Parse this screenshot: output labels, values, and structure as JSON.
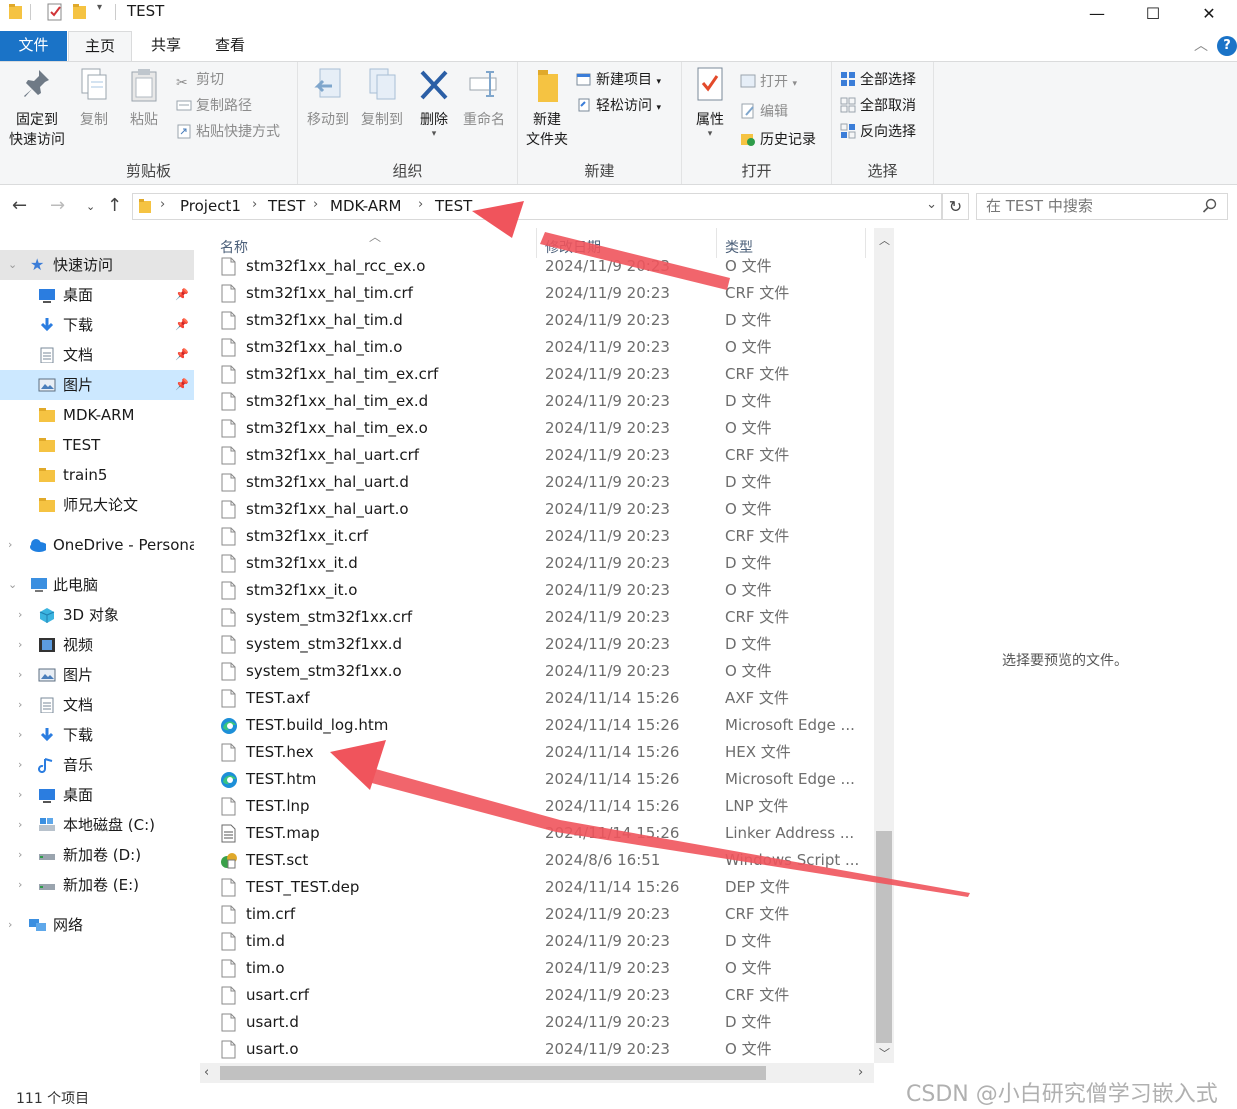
{
  "window": {
    "title": "TEST",
    "controls": {
      "minimize": "—",
      "maximize": "☐",
      "close": "✕"
    }
  },
  "ribbon_tabs": [
    "文件",
    "主页",
    "共享",
    "查看"
  ],
  "ribbon": {
    "clipboard": {
      "label": "剪贴板",
      "pin": "固定到\n快速访问",
      "pin_l1": "固定到",
      "pin_l2": "快速访问",
      "copy": "复制",
      "paste": "粘贴",
      "cut": "剪切",
      "copy_path": "复制路径",
      "paste_shortcut": "粘贴快捷方式"
    },
    "organize": {
      "label": "组织",
      "move_to": "移动到",
      "copy_to": "复制到",
      "delete": "删除",
      "rename": "重命名"
    },
    "new": {
      "label": "新建",
      "new_folder_l1": "新建",
      "new_folder_l2": "文件夹",
      "new_item": "新建项目",
      "easy_access": "轻松访问"
    },
    "open": {
      "label": "打开",
      "properties": "属性",
      "open": "打开",
      "edit": "编辑",
      "history": "历史记录"
    },
    "select": {
      "label": "选择",
      "select_all": "全部选择",
      "select_none": "全部取消",
      "invert": "反向选择"
    }
  },
  "breadcrumb": [
    "Project1",
    "TEST",
    "MDK-ARM",
    "TEST"
  ],
  "search": {
    "placeholder": "在 TEST 中搜索"
  },
  "nav": {
    "quick_access": "快速访问",
    "items": [
      {
        "label": "桌面",
        "icon": "desktop-icon",
        "pinned": true
      },
      {
        "label": "下载",
        "icon": "download-icon",
        "pinned": true
      },
      {
        "label": "文档",
        "icon": "document-icon",
        "pinned": true
      },
      {
        "label": "图片",
        "icon": "picture-icon",
        "pinned": true
      },
      {
        "label": "MDK-ARM",
        "icon": "folder-icon",
        "pinned": false
      },
      {
        "label": "TEST",
        "icon": "folder-icon",
        "pinned": false
      },
      {
        "label": "train5",
        "icon": "folder-icon",
        "pinned": false
      },
      {
        "label": "师兄大论文",
        "icon": "folder-icon",
        "pinned": false
      }
    ],
    "onedrive": "OneDrive - Persona",
    "this_pc": "此电脑",
    "pc_items": [
      {
        "label": "3D 对象",
        "icon": "cube-icon"
      },
      {
        "label": "视频",
        "icon": "video-icon"
      },
      {
        "label": "图片",
        "icon": "picture-icon"
      },
      {
        "label": "文档",
        "icon": "document-icon"
      },
      {
        "label": "下载",
        "icon": "download-icon"
      },
      {
        "label": "音乐",
        "icon": "music-icon"
      },
      {
        "label": "桌面",
        "icon": "desktop-icon"
      },
      {
        "label": "本地磁盘 (C:)",
        "icon": "disk-icon"
      },
      {
        "label": "新加卷 (D:)",
        "icon": "drive-icon"
      },
      {
        "label": "新加卷 (E:)",
        "icon": "drive-icon"
      }
    ],
    "network": "网络"
  },
  "columns": {
    "name": "名称",
    "date": "修改日期",
    "type": "类型"
  },
  "files": [
    {
      "name": "stm32f1xx_hal_rcc_ex.o",
      "date": "2024/11/9 20:23",
      "type": "O 文件",
      "icon": "file"
    },
    {
      "name": "stm32f1xx_hal_tim.crf",
      "date": "2024/11/9 20:23",
      "type": "CRF 文件",
      "icon": "file"
    },
    {
      "name": "stm32f1xx_hal_tim.d",
      "date": "2024/11/9 20:23",
      "type": "D 文件",
      "icon": "file"
    },
    {
      "name": "stm32f1xx_hal_tim.o",
      "date": "2024/11/9 20:23",
      "type": "O 文件",
      "icon": "file"
    },
    {
      "name": "stm32f1xx_hal_tim_ex.crf",
      "date": "2024/11/9 20:23",
      "type": "CRF 文件",
      "icon": "file"
    },
    {
      "name": "stm32f1xx_hal_tim_ex.d",
      "date": "2024/11/9 20:23",
      "type": "D 文件",
      "icon": "file"
    },
    {
      "name": "stm32f1xx_hal_tim_ex.o",
      "date": "2024/11/9 20:23",
      "type": "O 文件",
      "icon": "file"
    },
    {
      "name": "stm32f1xx_hal_uart.crf",
      "date": "2024/11/9 20:23",
      "type": "CRF 文件",
      "icon": "file"
    },
    {
      "name": "stm32f1xx_hal_uart.d",
      "date": "2024/11/9 20:23",
      "type": "D 文件",
      "icon": "file"
    },
    {
      "name": "stm32f1xx_hal_uart.o",
      "date": "2024/11/9 20:23",
      "type": "O 文件",
      "icon": "file"
    },
    {
      "name": "stm32f1xx_it.crf",
      "date": "2024/11/9 20:23",
      "type": "CRF 文件",
      "icon": "file"
    },
    {
      "name": "stm32f1xx_it.d",
      "date": "2024/11/9 20:23",
      "type": "D 文件",
      "icon": "file"
    },
    {
      "name": "stm32f1xx_it.o",
      "date": "2024/11/9 20:23",
      "type": "O 文件",
      "icon": "file"
    },
    {
      "name": "system_stm32f1xx.crf",
      "date": "2024/11/9 20:23",
      "type": "CRF 文件",
      "icon": "file"
    },
    {
      "name": "system_stm32f1xx.d",
      "date": "2024/11/9 20:23",
      "type": "D 文件",
      "icon": "file"
    },
    {
      "name": "system_stm32f1xx.o",
      "date": "2024/11/9 20:23",
      "type": "O 文件",
      "icon": "file"
    },
    {
      "name": "TEST.axf",
      "date": "2024/11/14 15:26",
      "type": "AXF 文件",
      "icon": "file"
    },
    {
      "name": "TEST.build_log.htm",
      "date": "2024/11/14 15:26",
      "type": "Microsoft Edge ...",
      "icon": "edge"
    },
    {
      "name": "TEST.hex",
      "date": "2024/11/14 15:26",
      "type": "HEX 文件",
      "icon": "file"
    },
    {
      "name": "TEST.htm",
      "date": "2024/11/14 15:26",
      "type": "Microsoft Edge ...",
      "icon": "edge"
    },
    {
      "name": "TEST.lnp",
      "date": "2024/11/14 15:26",
      "type": "LNP 文件",
      "icon": "file"
    },
    {
      "name": "TEST.map",
      "date": "2024/11/14 15:26",
      "type": "Linker Address ...",
      "icon": "text"
    },
    {
      "name": "TEST.sct",
      "date": "2024/8/6 16:51",
      "type": "Windows Script ...",
      "icon": "script"
    },
    {
      "name": "TEST_TEST.dep",
      "date": "2024/11/14 15:26",
      "type": "DEP 文件",
      "icon": "file"
    },
    {
      "name": "tim.crf",
      "date": "2024/11/9 20:23",
      "type": "CRF 文件",
      "icon": "file"
    },
    {
      "name": "tim.d",
      "date": "2024/11/9 20:23",
      "type": "D 文件",
      "icon": "file"
    },
    {
      "name": "tim.o",
      "date": "2024/11/9 20:23",
      "type": "O 文件",
      "icon": "file"
    },
    {
      "name": "usart.crf",
      "date": "2024/11/9 20:23",
      "type": "CRF 文件",
      "icon": "file"
    },
    {
      "name": "usart.d",
      "date": "2024/11/9 20:23",
      "type": "D 文件",
      "icon": "file"
    },
    {
      "name": "usart.o",
      "date": "2024/11/9 20:23",
      "type": "O 文件",
      "icon": "file"
    }
  ],
  "preview_message": "选择要预览的文件。",
  "status": "111 个项目",
  "watermark": "CSDN @小白研究僧学习嵌入式",
  "colors": {
    "accent": "#1a73c7",
    "selection": "#cce8ff",
    "annotation_arrow": "#f0545c",
    "folder": "#f5c342"
  }
}
